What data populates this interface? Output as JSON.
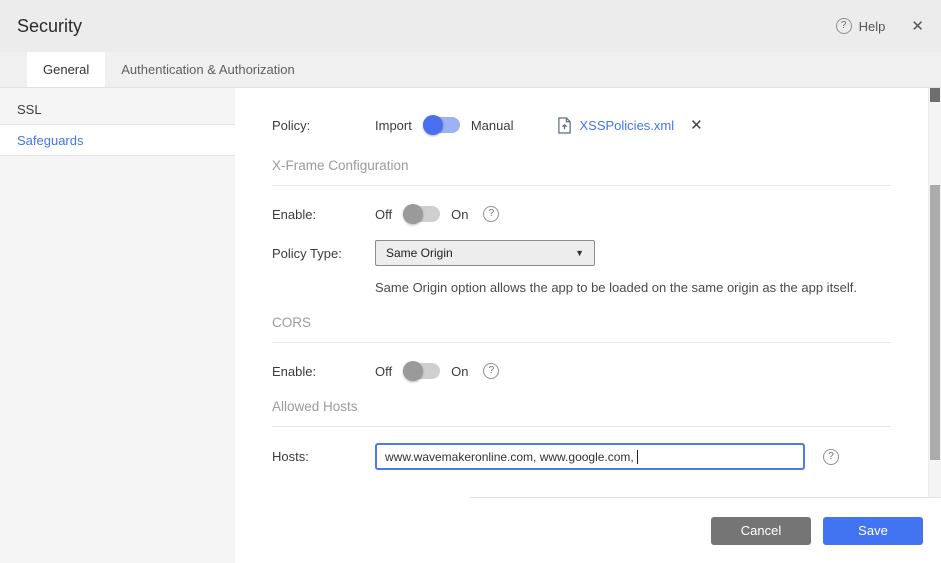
{
  "window": {
    "title": "Security",
    "help_label": "Help"
  },
  "icons": {
    "help": "?",
    "close": "✕",
    "select_caret": "▼"
  },
  "tabs": [
    {
      "label": "General",
      "active": true
    },
    {
      "label": "Authentication & Authorization",
      "active": false
    }
  ],
  "sidebar": {
    "items": [
      {
        "label": "SSL",
        "selected": false
      },
      {
        "label": "Safeguards",
        "selected": true
      }
    ]
  },
  "content": {
    "policy": {
      "label": "Policy:",
      "import_label": "Import",
      "manual_label": "Manual",
      "selected_mode": "Import",
      "file_name": "XSSPolicies.xml"
    },
    "xframe": {
      "title": "X-Frame Configuration",
      "enable_label": "Enable:",
      "off_label": "Off",
      "on_label": "On",
      "enable_state": "Off",
      "policy_type_label": "Policy Type:",
      "policy_type_value": "Same Origin",
      "description": "Same Origin option allows the app to be loaded on the same origin as the app itself."
    },
    "cors": {
      "title": "CORS",
      "enable_label": "Enable:",
      "off_label": "Off",
      "on_label": "On",
      "enable_state": "Off"
    },
    "allowed_hosts": {
      "title": "Allowed Hosts",
      "label": "Hosts:",
      "value": "www.wavemakeronline.com, www.google.com, "
    }
  },
  "footer": {
    "cancel": "Cancel",
    "save": "Save"
  },
  "colors": {
    "accent": "#4274f1",
    "link": "#4274f1",
    "save_button": "#4274f1",
    "cancel_button": "#757575",
    "toggle_on_knob": "#4a6ef0",
    "toggle_off_knob": "#9a9a9a"
  }
}
